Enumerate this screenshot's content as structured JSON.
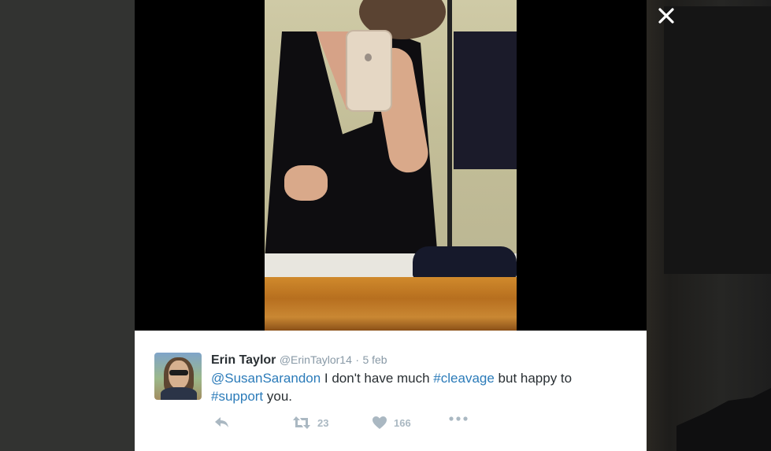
{
  "overlay": {
    "close_icon": "close-x-icon"
  },
  "tweet": {
    "author_name": "Erin Taylor",
    "author_handle": "@ErinTaylor14",
    "separator": "·",
    "date": "5 feb",
    "text": {
      "mention": "@SusanSarandon",
      "part1": " I don't have much ",
      "hashtag1": "#cleavage",
      "part2": " but happy to ",
      "hashtag2": "#support",
      "part3": " you."
    },
    "actions": {
      "reply_icon": "reply-icon",
      "retweet_icon": "retweet-icon",
      "retweet_count": "23",
      "like_icon": "heart-icon",
      "like_count": "166",
      "more_icon": "more-dots-icon"
    }
  },
  "colors": {
    "link": "#2b7bb9",
    "action_gray": "#aab8c2",
    "text": "#292f33",
    "muted": "#8899a6"
  }
}
